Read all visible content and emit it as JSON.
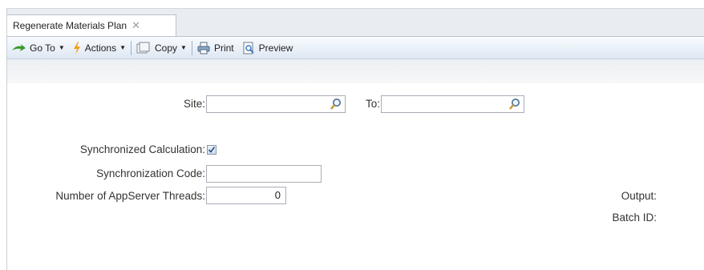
{
  "tab": {
    "title": "Regenerate Materials Plan",
    "close": "✕"
  },
  "toolbar": {
    "goto": "Go To",
    "actions": "Actions",
    "copy": "Copy",
    "print": "Print",
    "preview": "Preview",
    "dropdown_arrow": "▼"
  },
  "form": {
    "site_label": "Site:",
    "site_value": "",
    "to_label": "To:",
    "to_value": "",
    "sync_calc_label": "Synchronized Calculation:",
    "sync_calc_checked": true,
    "sync_code_label": "Synchronization Code:",
    "sync_code_value": "",
    "threads_label": "Number of AppServer Threads:",
    "threads_value": "0",
    "output_label": "Output:",
    "batch_label": "Batch ID:"
  },
  "icons": {
    "goto": "green-arrow-icon",
    "actions": "lightning-icon",
    "copy": "copy-icon",
    "print": "printer-icon",
    "preview": "preview-icon",
    "search": "magnifier-icon"
  }
}
